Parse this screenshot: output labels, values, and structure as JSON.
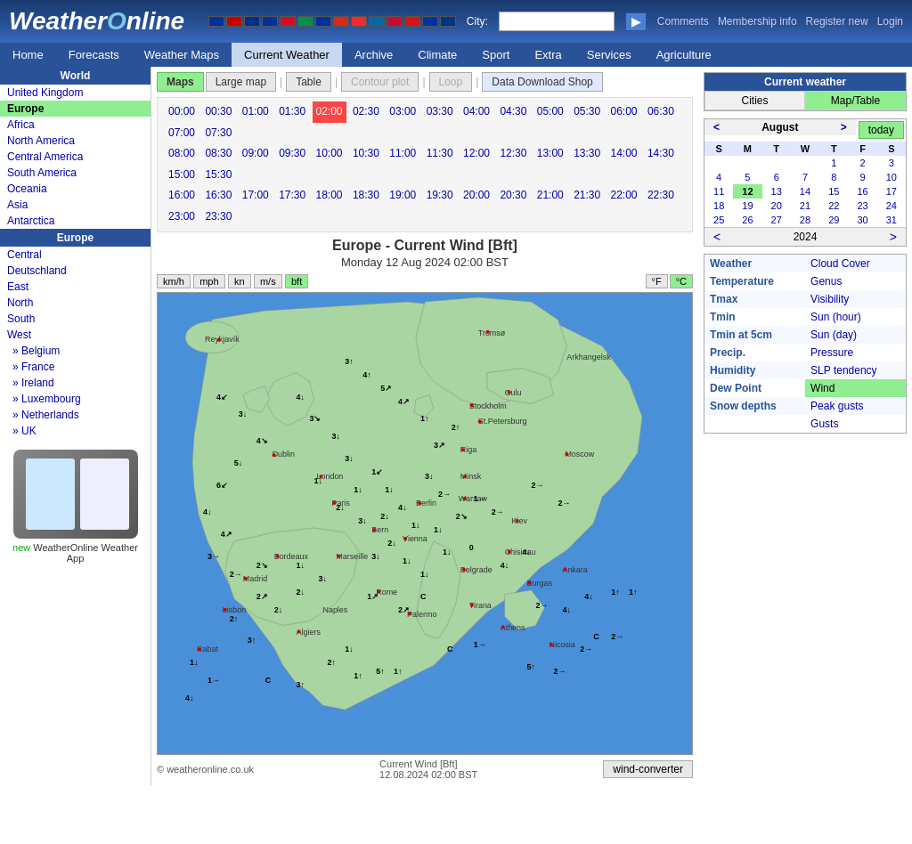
{
  "header": {
    "logo": "WeatherOnline",
    "city_label": "City:",
    "city_placeholder": "",
    "go_btn": "▶",
    "links": [
      "Comments",
      "Membership info",
      "Register new",
      "Login"
    ]
  },
  "nav": {
    "items": [
      "Home",
      "Forecasts",
      "Weather Maps",
      "Current Weather",
      "Archive",
      "Climate",
      "Sport",
      "Extra",
      "Services",
      "Agriculture"
    ],
    "active": "Current Weather"
  },
  "sidebar": {
    "world_title": "World",
    "world_items": [
      "United Kingdom",
      "Europe",
      "Africa",
      "North America",
      "Central America",
      "South America",
      "Oceania",
      "Asia",
      "Antarctica"
    ],
    "active_world": "Europe",
    "europe_title": "Europe",
    "europe_items": [
      "Central",
      "Deutschland",
      "East",
      "North",
      "South",
      "West"
    ],
    "europe_sub": [
      "» Belgium",
      "» France",
      "» Ireland",
      "» Luxembourg",
      "» Netherlands",
      "» UK"
    ],
    "app_new": "new",
    "app_label": "WeatherOnline Weather App"
  },
  "tabs": {
    "items": [
      "Maps",
      "Large map",
      "Table",
      "Contour plot",
      "Loop",
      "Data Download Shop"
    ],
    "active": "Maps"
  },
  "times": {
    "row1": [
      "00:00",
      "00:30",
      "01:00",
      "01:30",
      "02:00",
      "02:30",
      "03:00",
      "03:30",
      "04:00",
      "04:30",
      "05:00",
      "05:30",
      "06:00",
      "06:30",
      "07:00",
      "07:30"
    ],
    "row2": [
      "08:00",
      "08:30",
      "09:00",
      "09:30",
      "10:00",
      "10:30",
      "11:00",
      "11:30",
      "12:00",
      "12:30",
      "13:00",
      "13:30",
      "14:00",
      "14:30",
      "15:00",
      "15:30"
    ],
    "row3": [
      "16:00",
      "16:30",
      "17:00",
      "17:30",
      "18:00",
      "18:30",
      "19:00",
      "19:30",
      "20:00",
      "20:30",
      "21:00",
      "21:30",
      "22:00",
      "22:30",
      "23:00",
      "23:30"
    ],
    "active": "02:00"
  },
  "map": {
    "title": "Europe - Current Wind [Bft]",
    "subtitle": "Monday 12 Aug 2024 02:00 BST",
    "units": [
      "km/h",
      "mph",
      "kn",
      "m/s",
      "bft"
    ],
    "active_unit": "bft",
    "temp_units": [
      "°F",
      "°C"
    ],
    "active_temp": "°C",
    "copyright": "© weatheronline.co.uk",
    "footer_center": "Current Wind [Bft]",
    "footer_date": "12.08.2024  02:00 BST",
    "wind_converter": "wind-converter"
  },
  "right_panel": {
    "current_weather_title": "Current weather",
    "cities_tab": "Cities",
    "maptable_tab": "Map/Table",
    "today_btn": "today",
    "calendar": {
      "month": "August",
      "year": "2024",
      "days": [
        "S",
        "M",
        "T",
        "W",
        "T",
        "F",
        "S"
      ],
      "weeks": [
        [
          "",
          "",
          "",
          "",
          "1",
          "2",
          "3"
        ],
        [
          "4",
          "5",
          "6",
          "7",
          "8",
          "9",
          "10"
        ],
        [
          "11",
          "12",
          "13",
          "14",
          "15",
          "16",
          "17"
        ],
        [
          "18",
          "19",
          "20",
          "21",
          "22",
          "23",
          "24"
        ],
        [
          "25",
          "26",
          "27",
          "28",
          "29",
          "30",
          "31"
        ]
      ],
      "today": "12"
    },
    "weather_rows": [
      {
        "label": "Weather",
        "value": "Cloud Cover"
      },
      {
        "label": "Temperature",
        "value": "Genus"
      },
      {
        "label": "Tmax",
        "value": "Visibility"
      },
      {
        "label": "Tmin",
        "value": "Sun (hour)"
      },
      {
        "label": "Tmin at 5cm",
        "value": "Sun (day)"
      },
      {
        "label": "Precip.",
        "value": "Pressure"
      },
      {
        "label": "Humidity",
        "value": "SLP tendency"
      },
      {
        "label": "Dew Point",
        "value": "Wind"
      },
      {
        "label": "Snow depths",
        "value": "Peak gusts"
      },
      {
        "label": "",
        "value": "Gusts"
      }
    ],
    "active_weather": "Wind"
  }
}
